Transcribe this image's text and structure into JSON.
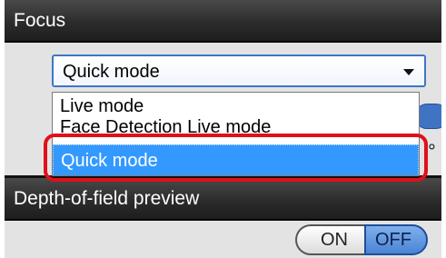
{
  "focus_section": {
    "title": "Focus",
    "dropdown": {
      "selected_value": "Quick mode",
      "options": [
        {
          "label": "Live mode"
        },
        {
          "label": "Face Detection Live mode"
        },
        {
          "label": "Quick mode"
        }
      ],
      "highlighted_option": "Quick mode"
    }
  },
  "dof_section": {
    "title": "Depth-of-field preview",
    "toggle": {
      "on_label": "ON",
      "off_label": "OFF",
      "active": "OFF"
    }
  },
  "colors": {
    "panel_header": "#2c2c2c",
    "panel_body": "#e3e3e3",
    "selection_blue": "#3399ff",
    "callout_red": "#e0101b",
    "active_toggle": "#4a84d4"
  },
  "icons": {
    "dropdown_arrow": "chevron-down-icon"
  }
}
